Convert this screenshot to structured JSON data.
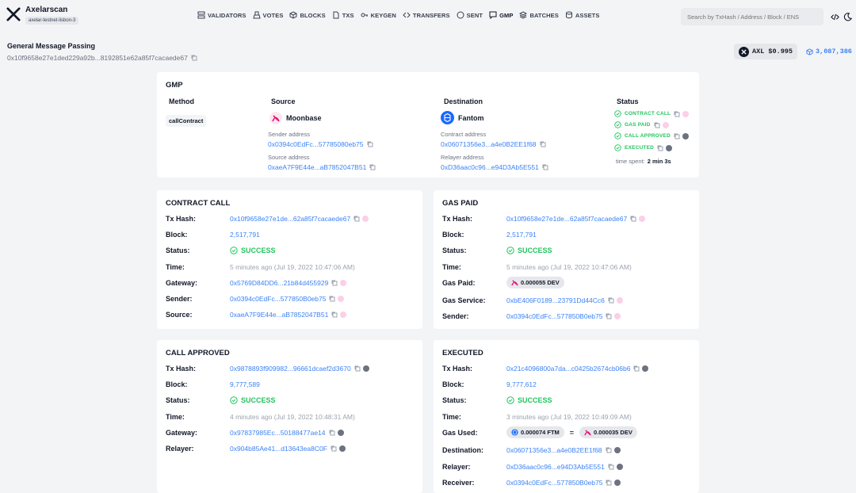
{
  "header": {
    "app_name": "Axelarscan",
    "network": "axelar-testnet-lisbon-3",
    "nav": [
      {
        "label": "VALIDATORS",
        "icon": "validators-icon"
      },
      {
        "label": "VOTES",
        "icon": "votes-icon"
      },
      {
        "label": "BLOCKS",
        "icon": "blocks-icon"
      },
      {
        "label": "TXS",
        "icon": "txs-icon"
      },
      {
        "label": "KEYGEN",
        "icon": "key-icon"
      },
      {
        "label": "TRANSFERS",
        "icon": "transfers-icon"
      },
      {
        "label": "SENT",
        "icon": "sent-icon"
      },
      {
        "label": "GMP",
        "icon": "gmp-icon"
      },
      {
        "label": "BATCHES",
        "icon": "batches-icon"
      },
      {
        "label": "ASSETS",
        "icon": "assets-icon"
      }
    ],
    "search_placeholder": "Search by TxHash / Address / Block / ENS"
  },
  "page": {
    "title": "General Message Passing",
    "tx_hash": "0x10f9658e27e1ded229a92b...8192851e62a85f7cacaede67",
    "price": "AXL $0.995",
    "latest_block": "3,087,386"
  },
  "gmp": {
    "title": "GMP",
    "method_header": "Method",
    "method": "callContract",
    "source_header": "Source",
    "source_chain": "Moonbase",
    "sender_label": "Sender address",
    "sender": "0x0394c0EdFc...57785080eb75",
    "source_address_label": "Source address",
    "source_address": "0xaeA7F9E44e...aB7852047B51",
    "destination_header": "Destination",
    "destination_chain": "Fantom",
    "contract_label": "Contract address",
    "contract": "0x06071356e3...a4e0B2EE1f68",
    "relayer_label": "Relayer address",
    "relayer": "0xD36aac0c96...e94D3Ab5E551",
    "status_header": "Status",
    "steps": [
      "CONTRACT CALL",
      "GAS PAID",
      "CALL APPROVED",
      "EXECUTED"
    ],
    "time_spent_label": "time spent:",
    "time_spent": "2 min 3s"
  },
  "labels": {
    "tx_hash": "Tx Hash:",
    "block": "Block:",
    "status": "Status:",
    "time": "Time:",
    "gateway": "Gateway:",
    "sender": "Sender:",
    "source": "Source:",
    "gas_paid": "Gas Paid:",
    "gas_service": "Gas Service:",
    "relayer": "Relayer:",
    "gas_used": "Gas Used:",
    "destination": "Destination:",
    "receiver": "Receiver:"
  },
  "contract_call": {
    "title": "CONTRACT CALL",
    "tx_hash": "0x10f9658e27e1de...62a85f7cacaede67",
    "block": "2,517,791",
    "status": "SUCCESS",
    "time": "5 minutes ago (Jul 19, 2022 10:47:06 AM)",
    "gateway": "0x5769D84DD6...21b84d455929",
    "sender": "0x0394c0EdFc...577850B0eb75",
    "source": "0xaeA7F9E44e...aB7852047B51"
  },
  "gas_paid": {
    "title": "GAS PAID",
    "tx_hash": "0x10f9658e27e1de...62a85f7cacaede67",
    "block": "2,517,791",
    "status": "SUCCESS",
    "time": "5 minutes ago (Jul 19, 2022 10:47:06 AM)",
    "gas_paid": "0.000055 DEV",
    "gas_service": "0xbE406F0189...23791Dd44Cc6",
    "sender": "0x0394c0EdFc...577850B0eb75"
  },
  "call_approved": {
    "title": "CALL APPROVED",
    "tx_hash": "0x9878893f909982...96661dcaef2d3670",
    "block": "9,777,589",
    "status": "SUCCESS",
    "time": "4 minutes ago (Jul 19, 2022 10:48:31 AM)",
    "gateway": "0x97837985Ec...50188477ae14",
    "relayer": "0x904b85Ae41...d13643ea8C0F"
  },
  "executed": {
    "title": "EXECUTED",
    "tx_hash": "0x21c4096800a7da...c0425b2674cb06b6",
    "block": "9,777,612",
    "status": "SUCCESS",
    "time": "3 minutes ago (Jul 19, 2022 10:49:09 AM)",
    "gas_used_ftm": "0.000074 FTM",
    "eq": "=",
    "gas_used_dev": "0.000035 DEV",
    "destination": "0x06071356e3...a4e0B2EE1f68",
    "relayer": "0xD36aac0c96...e94D3Ab5E551",
    "receiver": "0x0394c0EdFc...577850B0eb75"
  },
  "colors": {
    "link": "#3b82f6",
    "success": "#22c55e",
    "moonbase": "#e1147b",
    "fantom": "#1969ff"
  }
}
